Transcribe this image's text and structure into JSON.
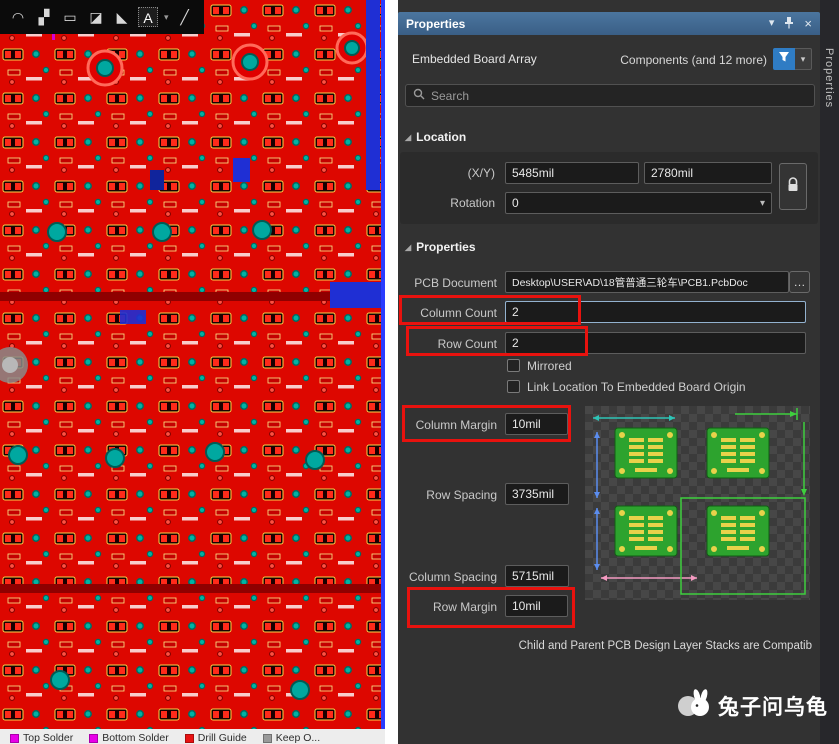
{
  "glyphs": {
    "chevron_down": "▾",
    "close": "×",
    "more": "…",
    "section_triangle": "◢",
    "caret": "▾"
  },
  "pcb_toolbar": {
    "icons": [
      {
        "name": "arc-tool-icon",
        "glyph": "◠"
      },
      {
        "name": "route-tool-icon",
        "glyph": "▞"
      },
      {
        "name": "fill-tool-icon",
        "glyph": "▭"
      },
      {
        "name": "polygon-pour-icon",
        "glyph": "◪"
      },
      {
        "name": "slice-tool-icon",
        "glyph": "◣"
      },
      {
        "name": "string-tool-icon",
        "glyph": "A"
      },
      {
        "name": "line-tool-icon",
        "glyph": "╱"
      }
    ]
  },
  "layer_tabs": [
    {
      "label": "Top Solder",
      "color": "#e800e8"
    },
    {
      "label": "Bottom Solder",
      "color": "#e800e8"
    },
    {
      "label": "Drill Guide",
      "color": "#e81212"
    },
    {
      "label": "Keep O...",
      "color": "#9a9a9a"
    }
  ],
  "panel": {
    "title": "Properties",
    "object_type": "Embedded Board Array",
    "scope_label": "Components (and 12 more)",
    "search": {
      "placeholder": "Search"
    },
    "location": {
      "section_title": "Location",
      "xy_label": "(X/Y)",
      "x": "5485mil",
      "y": "2780mil",
      "rotation_label": "Rotation",
      "rotation": "0"
    },
    "properties": {
      "section_title": "Properties",
      "pcb_document_label": "PCB Document",
      "pcb_document": "Desktop\\USER\\AD\\18管普通三轮车\\PCB1.PcbDoc",
      "column_count_label": "Column Count",
      "column_count": "2",
      "row_count_label": "Row Count",
      "row_count": "2",
      "mirrored_label": "Mirrored",
      "mirrored_checked": false,
      "link_label": "Link Location To Embedded Board Origin",
      "link_checked": false,
      "column_margin_label": "Column Margin",
      "column_margin": "10mil",
      "row_spacing_label": "Row Spacing",
      "row_spacing": "3735mil",
      "column_spacing_label": "Column Spacing",
      "column_spacing": "5715mil",
      "row_margin_label": "Row Margin",
      "row_margin": "10mil"
    },
    "footer_note": "Child and Parent PCB Design Layer Stacks are Compatib",
    "side_tab_vertical": "Properties"
  },
  "watermark": {
    "text": "兔子问乌龟"
  },
  "colors": {
    "header_blue": "#3f6a99",
    "annotation_red": "#e8120e",
    "board_green": "#2da32e",
    "pad_yellow": "#e8d24a",
    "copper_red": "#dd0700",
    "via_teal": "#00b3a4",
    "bottom_layer_blue": "#1f2fd4"
  }
}
